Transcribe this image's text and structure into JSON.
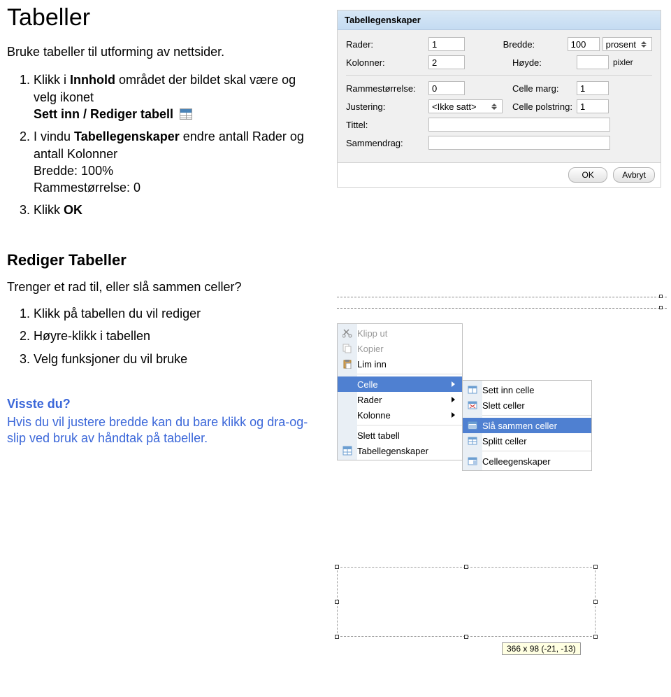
{
  "heading": "Tabeller",
  "intro": "Bruke tabeller til utforming av nettsider.",
  "steps1": {
    "s1a": "Klikk i ",
    "s1b": "Innhold ",
    "s1c": "området der bildet skal være og velg ikonet",
    "s1d": "Sett inn / Rediger tabell",
    "s2a": "I vindu ",
    "s2b": "Tabellegenskaper ",
    "s2c": "endre antall Rader og antall Kolonner",
    "s2d": "Bredde: 100%",
    "s2e": "Rammestørrelse: 0",
    "s3a": "Klikk ",
    "s3b": "OK"
  },
  "heading2": "Rediger Tabeller",
  "intro2": "Trenger et rad til, eller slå sammen celler?",
  "steps2": {
    "s1": "Klikk på tabellen du vil rediger",
    "s2": "Høyre-klikk i tabellen",
    "s3": "Velg funksjoner du vil bruke"
  },
  "tip": {
    "title": "Visste du?",
    "body": "Hvis du vil justere bredde kan du bare klikk og dra-og-slip ved bruk av håndtak på tabeller."
  },
  "dialog": {
    "title": "Tabellegenskaper",
    "rader_lbl": "Rader:",
    "rader_val": "1",
    "bredde_lbl": "Bredde:",
    "bredde_val": "100",
    "bredde_unit": "prosent",
    "kol_lbl": "Kolonner:",
    "kol_val": "2",
    "hoyde_lbl": "Høyde:",
    "hoyde_val": "",
    "hoyde_unit": "pixler",
    "ramme_lbl": "Rammestørrelse:",
    "ramme_val": "0",
    "cmarg_lbl": "Celle marg:",
    "cmarg_val": "1",
    "just_lbl": "Justering:",
    "just_val": "<Ikke satt>",
    "cpol_lbl": "Celle polstring:",
    "cpol_val": "1",
    "tittel_lbl": "Tittel:",
    "tittel_val": "",
    "sam_lbl": "Sammendrag:",
    "sam_val": "",
    "ok": "OK",
    "cancel": "Avbryt"
  },
  "menu": {
    "cut": "Klipp ut",
    "copy": "Kopier",
    "paste": "Lim inn",
    "celle": "Celle",
    "rader": "Rader",
    "kolonne": "Kolonne",
    "slett": "Slett tabell",
    "egen": "Tabellegenskaper"
  },
  "submenu": {
    "settinn": "Sett inn celle",
    "slett": "Slett celler",
    "sla": "Slå sammen celler",
    "splitt": "Splitt celler",
    "celle_egen": "Celleegenskaper"
  },
  "dim_tip": "366 x 98 (-21, -13)"
}
